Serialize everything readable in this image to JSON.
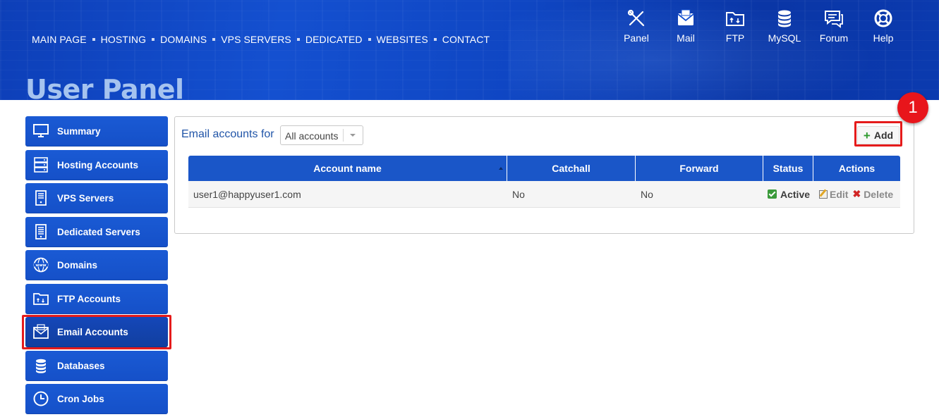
{
  "top_nav": [
    "MAIN PAGE",
    "HOSTING",
    "DOMAINS",
    "VPS SERVERS",
    "DEDICATED",
    "WEBSITES",
    "CONTACT"
  ],
  "icon_nav": [
    {
      "label": "Panel",
      "icon": "tools-icon"
    },
    {
      "label": "Mail",
      "icon": "mail-icon"
    },
    {
      "label": "FTP",
      "icon": "ftp-folder-icon"
    },
    {
      "label": "MySQL",
      "icon": "database-icon"
    },
    {
      "label": "Forum",
      "icon": "forum-icon"
    },
    {
      "label": "Help",
      "icon": "lifebuoy-icon"
    }
  ],
  "page_title": "User Panel",
  "sidebar": {
    "items": [
      {
        "label": "Summary",
        "icon": "monitor-icon"
      },
      {
        "label": "Hosting Accounts",
        "icon": "server-icon"
      },
      {
        "label": "VPS Servers",
        "icon": "vps-icon"
      },
      {
        "label": "Dedicated Servers",
        "icon": "dedicated-server-icon"
      },
      {
        "label": "Domains",
        "icon": "globe-www-icon"
      },
      {
        "label": "FTP Accounts",
        "icon": "ftp-folder-icon"
      },
      {
        "label": "Email Accounts",
        "icon": "mail-icon"
      },
      {
        "label": "Databases",
        "icon": "database-icon"
      },
      {
        "label": "Cron Jobs",
        "icon": "clock-icon"
      }
    ],
    "active_index": 6
  },
  "main": {
    "filter_label": "Email accounts for",
    "filter_value": "All accounts",
    "add_label": "Add",
    "badge": "1",
    "table": {
      "headers": [
        "Account name",
        "Catchall",
        "Forward",
        "Status",
        "Actions"
      ],
      "rows": [
        {
          "account": "user1@happyuser1.com",
          "catchall": "No",
          "forward": "No",
          "status": "Active",
          "edit": "Edit",
          "delete": "Delete"
        }
      ]
    }
  },
  "colors": {
    "accent": "#1a56c8",
    "highlight": "#e51b1b",
    "badge": "#e8151b",
    "title": "#a5c3ef"
  }
}
